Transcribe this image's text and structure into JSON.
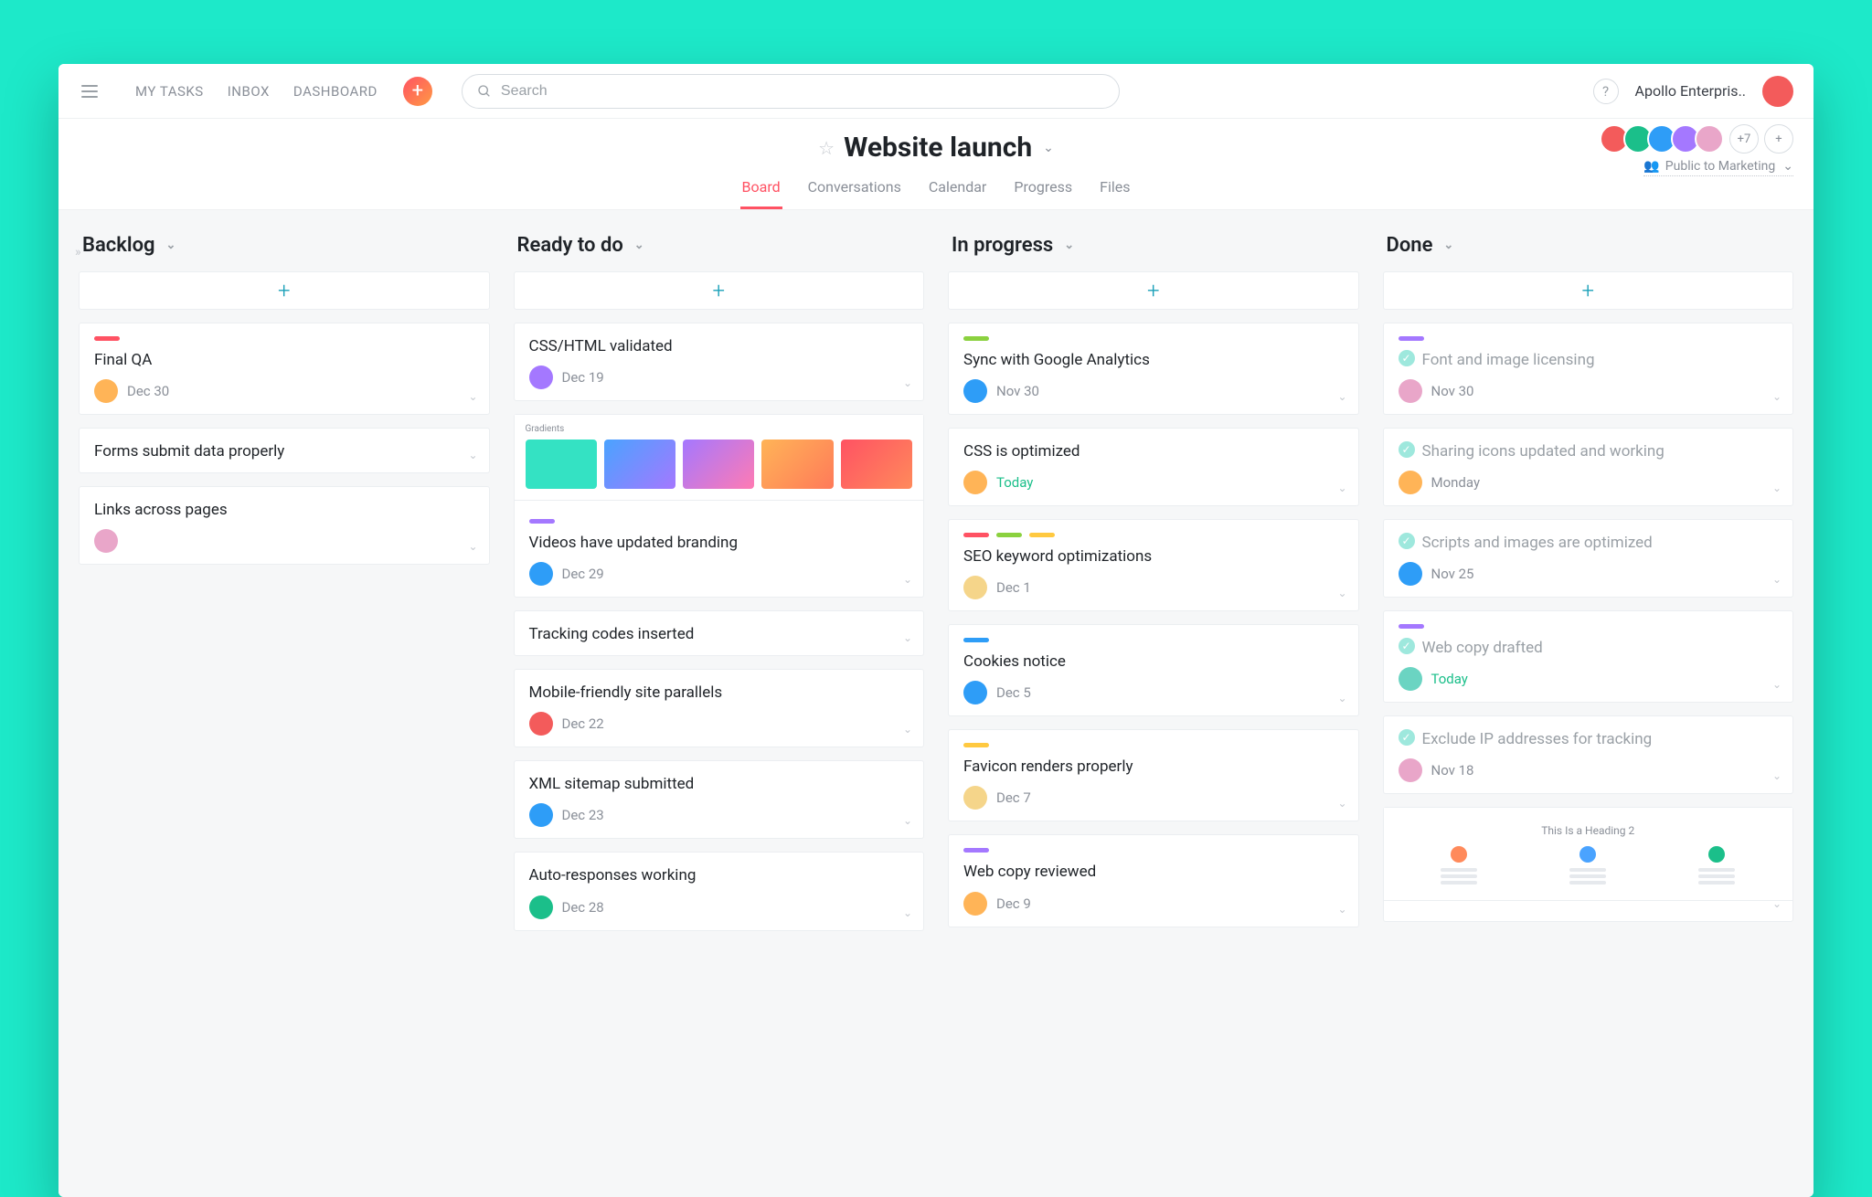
{
  "topbar": {
    "nav": [
      "MY TASKS",
      "INBOX",
      "DASHBOARD"
    ],
    "search_placeholder": "Search",
    "org_name": "Apollo Enterpris..",
    "help": "?"
  },
  "project": {
    "title": "Website launch",
    "tabs": [
      "Board",
      "Conversations",
      "Calendar",
      "Progress",
      "Files"
    ],
    "active_tab": "Board",
    "members_extra": "+7",
    "visibility": "Public to Marketing"
  },
  "columns": [
    {
      "name": "Backlog",
      "cards": [
        {
          "title": "Final QA",
          "tags": [
            "c-red"
          ],
          "due": "Dec 30",
          "avatar": "av-e"
        },
        {
          "title": "Forms submit data properly",
          "tags": [],
          "due": "",
          "avatar": ""
        },
        {
          "title": "Links across pages",
          "tags": [],
          "due": "",
          "avatar": "av-f"
        }
      ]
    },
    {
      "name": "Ready to do",
      "cards": [
        {
          "title": "CSS/HTML validated",
          "tags": [],
          "due": "Dec 19",
          "avatar": "av-d"
        },
        {
          "title": "Videos have updated branding",
          "tags": [
            "c-purple"
          ],
          "due": "Dec 29",
          "avatar": "av-c",
          "thumb": "gradients"
        },
        {
          "title": "Tracking codes inserted",
          "tags": [],
          "due": "",
          "avatar": ""
        },
        {
          "title": "Mobile-friendly site parallels",
          "tags": [],
          "due": "Dec 22",
          "avatar": "av-a"
        },
        {
          "title": "XML sitemap submitted",
          "tags": [],
          "due": "Dec 23",
          "avatar": "av-c"
        },
        {
          "title": "Auto-responses working",
          "tags": [],
          "due": "Dec 28",
          "avatar": "av-b"
        }
      ]
    },
    {
      "name": "In progress",
      "cards": [
        {
          "title": "Sync with Google Analytics",
          "tags": [
            "c-green"
          ],
          "due": "Nov 30",
          "avatar": "av-c"
        },
        {
          "title": "CSS is optimized",
          "tags": [],
          "due": "Today",
          "due_today": true,
          "avatar": "av-e"
        },
        {
          "title": "SEO keyword optimizations",
          "tags": [
            "c-red",
            "c-green",
            "c-yellow"
          ],
          "due": "Dec 1",
          "avatar": "av-h"
        },
        {
          "title": "Cookies notice",
          "tags": [
            "c-blue"
          ],
          "due": "Dec 5",
          "avatar": "av-c"
        },
        {
          "title": "Favicon renders properly",
          "tags": [
            "c-yellow"
          ],
          "due": "Dec 7",
          "avatar": "av-h"
        },
        {
          "title": "Web copy reviewed",
          "tags": [
            "c-purple"
          ],
          "due": "Dec 9",
          "avatar": "av-e"
        }
      ]
    },
    {
      "name": "Done",
      "cards": [
        {
          "title": "Font and image licensing",
          "tags": [
            "c-purple"
          ],
          "due": "Nov 30",
          "avatar": "av-f",
          "done": true
        },
        {
          "title": "Sharing icons updated and working",
          "tags": [],
          "due": "Monday",
          "avatar": "av-e",
          "done": true
        },
        {
          "title": "Scripts and images are optimized",
          "tags": [],
          "due": "Nov 25",
          "avatar": "av-c",
          "done": true
        },
        {
          "title": "Web copy drafted",
          "tags": [
            "c-purple"
          ],
          "due": "Today",
          "due_today": true,
          "avatar": "av-g",
          "done": true
        },
        {
          "title": "Exclude IP addresses for tracking",
          "tags": [],
          "due": "Nov 18",
          "avatar": "av-f",
          "done": true
        },
        {
          "title": "",
          "thumb": "people",
          "done": true
        }
      ]
    }
  ],
  "thumbs": {
    "gradients_label": "Gradients",
    "people_title": "This Is a Heading 2"
  }
}
